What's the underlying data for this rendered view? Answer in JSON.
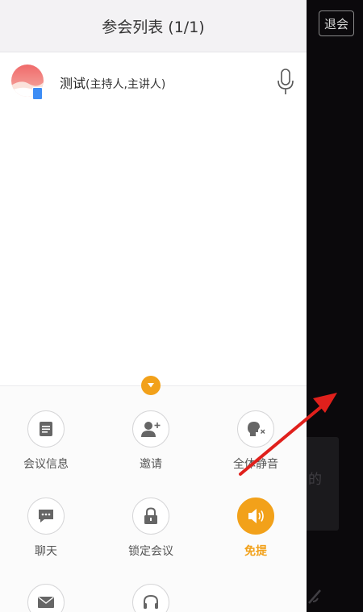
{
  "header": {
    "title": "参会列表 (1/1)"
  },
  "participants": [
    {
      "name": "测试",
      "role": "(主持人,主讲人)"
    }
  ],
  "actions": [
    {
      "label": "会议信息",
      "icon": "document-icon"
    },
    {
      "label": "邀请",
      "icon": "add-user-icon"
    },
    {
      "label": "全体静音",
      "icon": "mute-all-icon"
    },
    {
      "label": "聊天",
      "icon": "chat-icon"
    },
    {
      "label": "锁定会议",
      "icon": "lock-icon"
    },
    {
      "label": "免提",
      "icon": "speaker-icon"
    },
    {
      "label": "",
      "icon": "mail-icon"
    },
    {
      "label": "",
      "icon": "headset-icon"
    }
  ],
  "right_panel": {
    "leave_label": "退会",
    "partial_text": "的"
  },
  "colors": {
    "accent": "#f2a11a",
    "panel_bg": "#ffffff",
    "dark_bg": "#0b090c",
    "arrow": "#e0201c"
  }
}
